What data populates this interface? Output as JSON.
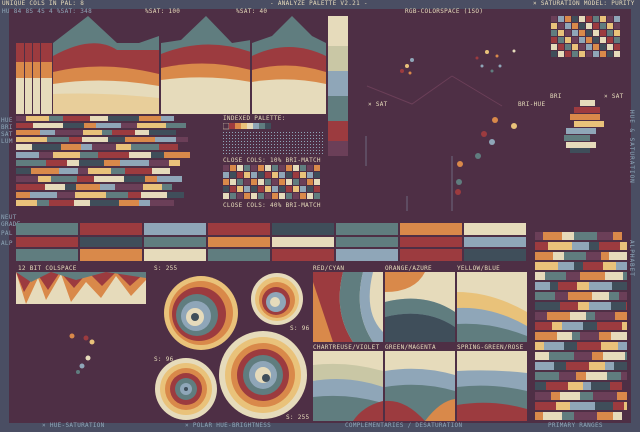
{
  "header": {
    "unique_cols": "UNIQUE COLS IN PAL: 8",
    "sat_100": "%SAT: 100",
    "sat_40": "%SAT: 40",
    "title": "- ANALYZE PALETTE V2.21 -",
    "colorspace": "RGB-COLORSPACE (1SO)",
    "saturation_model": "× SATURATION MODEL: PURITY",
    "sub_info": "HU 84 8S 4S 4 %SAT: 348"
  },
  "left_labels": {
    "hue": "HUE",
    "brightness": "BRI",
    "saturation": "SAT",
    "lum": "LUM",
    "neut": "NEUT",
    "grade": "GRADE",
    "pal": "PAL",
    "alp": "ALP"
  },
  "labels": {
    "indexed_palette": "INDEXED PALETTE:",
    "close_cols_10": "CLOSE COLS: 10% BRI-MATCH",
    "close_cols_40": "CLOSE COLS: 40% BRI-MATCH",
    "x_sat": "× SAT",
    "bri_hue": "BRI-HUE",
    "bri": "BRI",
    "x_sat_right": "× SAT",
    "colspace_12bit": "12 BIT COLSPACE",
    "s255_top": "S: 255",
    "s96_a": "S: 96",
    "s96_b": "S: 96",
    "s255_bottom": "S: 255",
    "red_cyan": "RED/CYAN",
    "orange_azure": "ORANGE/AZURE",
    "yellow_blue": "YELLOW/BLUE",
    "chartreuse_violet": "CHARTREUSE/VIOLET",
    "green_magenta": "GREEN/MAGENTA",
    "spring_rose": "SPRING-GREEN/ROSE"
  },
  "footer": {
    "hue_saturation": "× HUE-SATURATION",
    "polar": "× POLAR HUE-BRIGHTNESS",
    "complementaries": "COMPLEMENTARIES / DESATURATION",
    "primary_ranges": "PRIMARY RANGES"
  },
  "right_side": {
    "label1": "HUE & SATURATION",
    "label2": "ALPHABET"
  },
  "palette": {
    "plum_dark": "#4e2f45",
    "plum": "#6b3f58",
    "red": "#9c3b3f",
    "orange": "#d9894a",
    "yellow": "#e9c27a",
    "cream": "#e6dbbb",
    "teal": "#607d7f",
    "blue_grey": "#8fa6b8",
    "slate": "#3f4e5a",
    "frame": "#4a4e63"
  }
}
